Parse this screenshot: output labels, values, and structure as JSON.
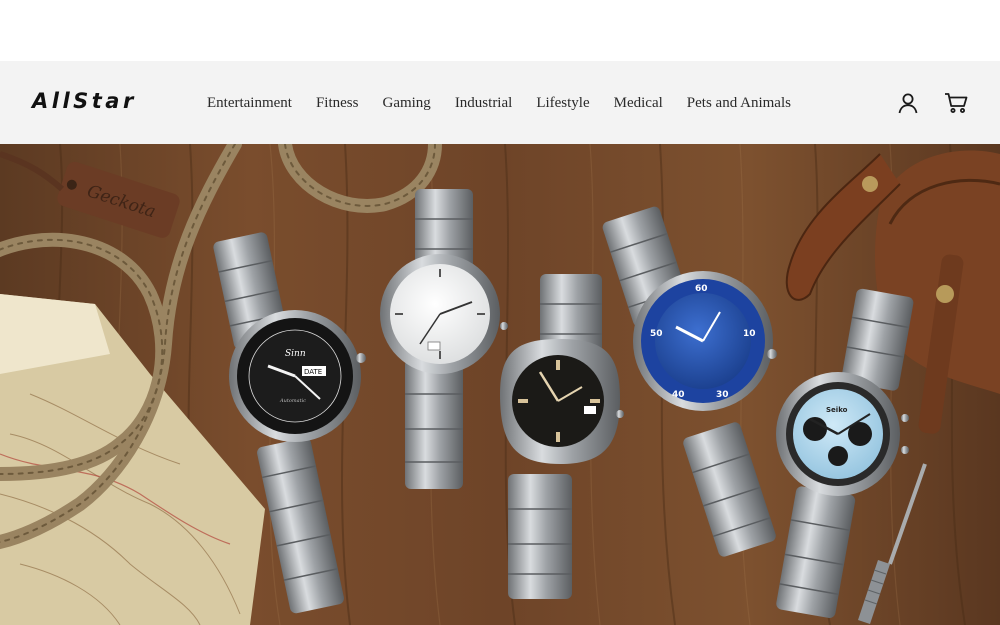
{
  "header": {
    "logo": "AllStar",
    "nav": [
      {
        "label": "Entertainment"
      },
      {
        "label": "Fitness"
      },
      {
        "label": "Gaming"
      },
      {
        "label": "Industrial"
      },
      {
        "label": "Lifestyle"
      },
      {
        "label": "Medical"
      },
      {
        "label": "Pets and Animals"
      }
    ],
    "icons": {
      "account": "user-icon",
      "cart": "cart-icon"
    }
  },
  "hero": {
    "image_subject": "Five stainless steel bracelet watches laid on a wooden table with rope, map and leather bag",
    "watch_dial_text": [
      "Sinn",
      "DATE",
      "Automatic",
      "Seiko"
    ],
    "tag_text": "Geckota",
    "colors": {
      "wood": "#6b4328",
      "header_bg": "#f3f3f3",
      "text": "#2a2a2a"
    }
  }
}
